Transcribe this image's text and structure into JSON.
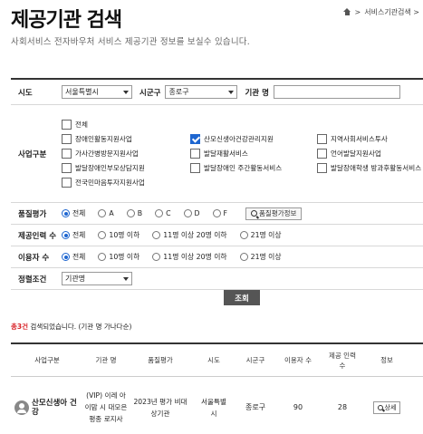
{
  "header": {
    "title": "제공기관 검색",
    "breadcrumb_current": "서비스기관검색 >",
    "subtitle": "사회서비스 전자바우처 서비스 제공기관 정보를 보실수 있습니다."
  },
  "filters": {
    "region_label": "시도",
    "region_value": "서울특별시",
    "district_label": "시군구",
    "district_value": "종로구",
    "org_name_label": "기관 명",
    "business_label": "사업구분",
    "business_options": [
      {
        "label": "전체",
        "checked": false
      },
      {
        "label": "장애인활동지원사업",
        "checked": false
      },
      {
        "label": "산모신생아건강관리지원",
        "checked": true
      },
      {
        "label": "지역사회서비스투사",
        "checked": false
      },
      {
        "label": "가사간병방문지원사업",
        "checked": false
      },
      {
        "label": "발달재활서비스",
        "checked": false
      },
      {
        "label": "언어발달지원사업",
        "checked": false
      },
      {
        "label": "발달장애인부모상담지원",
        "checked": false
      },
      {
        "label": "발달장애인 주간활동서비스",
        "checked": false
      },
      {
        "label": "발달장애학생 방과후활동서비스",
        "checked": false
      },
      {
        "label": "전국민마음투자지원사업",
        "checked": false
      }
    ],
    "quality_label": "품질평가",
    "quality_options": [
      {
        "label": "전체",
        "selected": true
      },
      {
        "label": "A",
        "selected": false
      },
      {
        "label": "B",
        "selected": false
      },
      {
        "label": "C",
        "selected": false
      },
      {
        "label": "D",
        "selected": false
      },
      {
        "label": "F",
        "selected": false
      }
    ],
    "quality_info_button": "품질평가정보",
    "staff_label": "제공인력 수",
    "staff_options": [
      {
        "label": "전체",
        "selected": true
      },
      {
        "label": "10명 이하",
        "selected": false
      },
      {
        "label": "11명 이상 20명 이하",
        "selected": false
      },
      {
        "label": "21명 이상",
        "selected": false
      }
    ],
    "users_label": "이용자 수",
    "users_options": [
      {
        "label": "전체",
        "selected": true
      },
      {
        "label": "10명 이하",
        "selected": false
      },
      {
        "label": "11명 이상 20명 이하",
        "selected": false
      },
      {
        "label": "21명 이상",
        "selected": false
      }
    ],
    "sort_label": "정렬조건",
    "sort_value": "기관명",
    "search_button": "조회"
  },
  "results": {
    "count_text": "총3건",
    "summary_text": " 검색되었습니다. (기관 명 가나다순)",
    "headers": [
      "사업구분",
      "기관 명",
      "품질평가",
      "시도",
      "시군구",
      "이용자 수",
      "제공 인력 수",
      "정보"
    ],
    "rows": [
      {
        "business": "산모신생아 건강",
        "org_name": "(VIP) 이레 아이맘 시 대모은평종 로지사",
        "quality": "2023년 평가 비대상기관",
        "region": "서울특별 시",
        "district": "종로구",
        "users": "90",
        "staff": "28",
        "detail": "상세"
      }
    ]
  }
}
